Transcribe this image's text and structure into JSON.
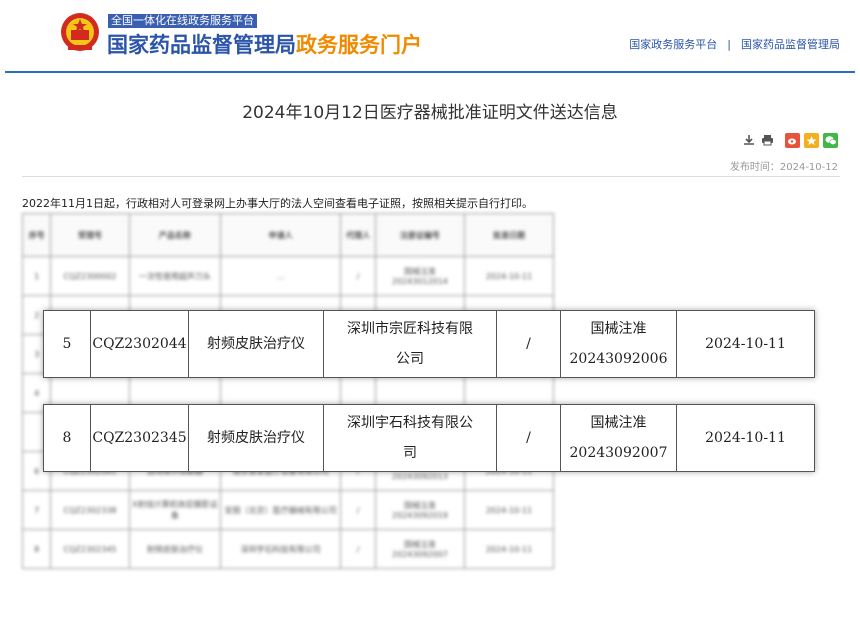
{
  "header": {
    "portal_small": "全国一体化在线政务服务平台",
    "title_main": "国家药品监督管理局",
    "title_accent": "政务服务门户",
    "links": [
      "国家政务服务平台",
      "国家药品监督管理局"
    ],
    "link_separator": "|"
  },
  "article": {
    "title": "2024年10月12日医疗器械批准证明文件送达信息",
    "publish_time": "发布时间：2024-10-12",
    "notice": "2022年11月1日起，行政相对人可登录网上办事大厅的法人空间查看电子证照，按照相关提示自行打印。",
    "tools": [
      "download-icon",
      "print-icon",
      "weibo-icon",
      "qzone-icon",
      "wechat-icon"
    ]
  },
  "table": {
    "headers": [
      "序号",
      "受理号",
      "产品名称",
      "申请人",
      "代理人",
      "注册证编号",
      "批准日期"
    ],
    "blurred_rows": [
      [
        "1",
        "CQZ2300002",
        "一次性使用超声刀头",
        "…",
        "/",
        "国械注准20243012014",
        "2024-10-11"
      ],
      [
        "2",
        "",
        "",
        "",
        "",
        "",
        ""
      ],
      [
        "3",
        "",
        "",
        "",
        "",
        "",
        ""
      ],
      [
        "4",
        "",
        "",
        "",
        "",
        "",
        ""
      ],
      [
        "",
        "",
        "",
        "",
        "",
        "",
        ""
      ],
      [
        "6",
        "CQZ2302081",
        "自动体外除颤器",
        "南京普爱医疗设备有限公司",
        "/",
        "国械注准20243092013",
        "2024-10-11"
      ],
      [
        "7",
        "CQZ2302338",
        "X射线计算机体层摄影设备",
        "安图（北京）医疗器械有限公司",
        "/",
        "国械注准20243092019",
        "2024-10-11"
      ],
      [
        "8",
        "CQZ2302345",
        "射频皮肤治疗仪",
        "深圳宇石科技有限公司",
        "/",
        "国械注准20243092007",
        "2024-10-11"
      ]
    ],
    "highlighted_rows": [
      {
        "no": "5",
        "accept_no": "CQZ2302044",
        "product": "射频皮肤治疗仪",
        "applicant_line1": "深圳市宗匠科技有限",
        "applicant_line2": "公司",
        "agent": "/",
        "reg_line1": "国械注准",
        "reg_line2": "20243092006",
        "date": "2024-10-11"
      },
      {
        "no": "8",
        "accept_no": "CQZ2302345",
        "product": "射频皮肤治疗仪",
        "applicant_line1": "深圳宇石科技有限公",
        "applicant_line2": "司",
        "agent": "/",
        "reg_line1": "国械注准",
        "reg_line2": "20243092007",
        "date": "2024-10-11"
      }
    ]
  },
  "colors": {
    "brand_blue": "#2b55a8",
    "accent_orange": "#f08a00",
    "rule_blue": "#2b6cc4"
  }
}
